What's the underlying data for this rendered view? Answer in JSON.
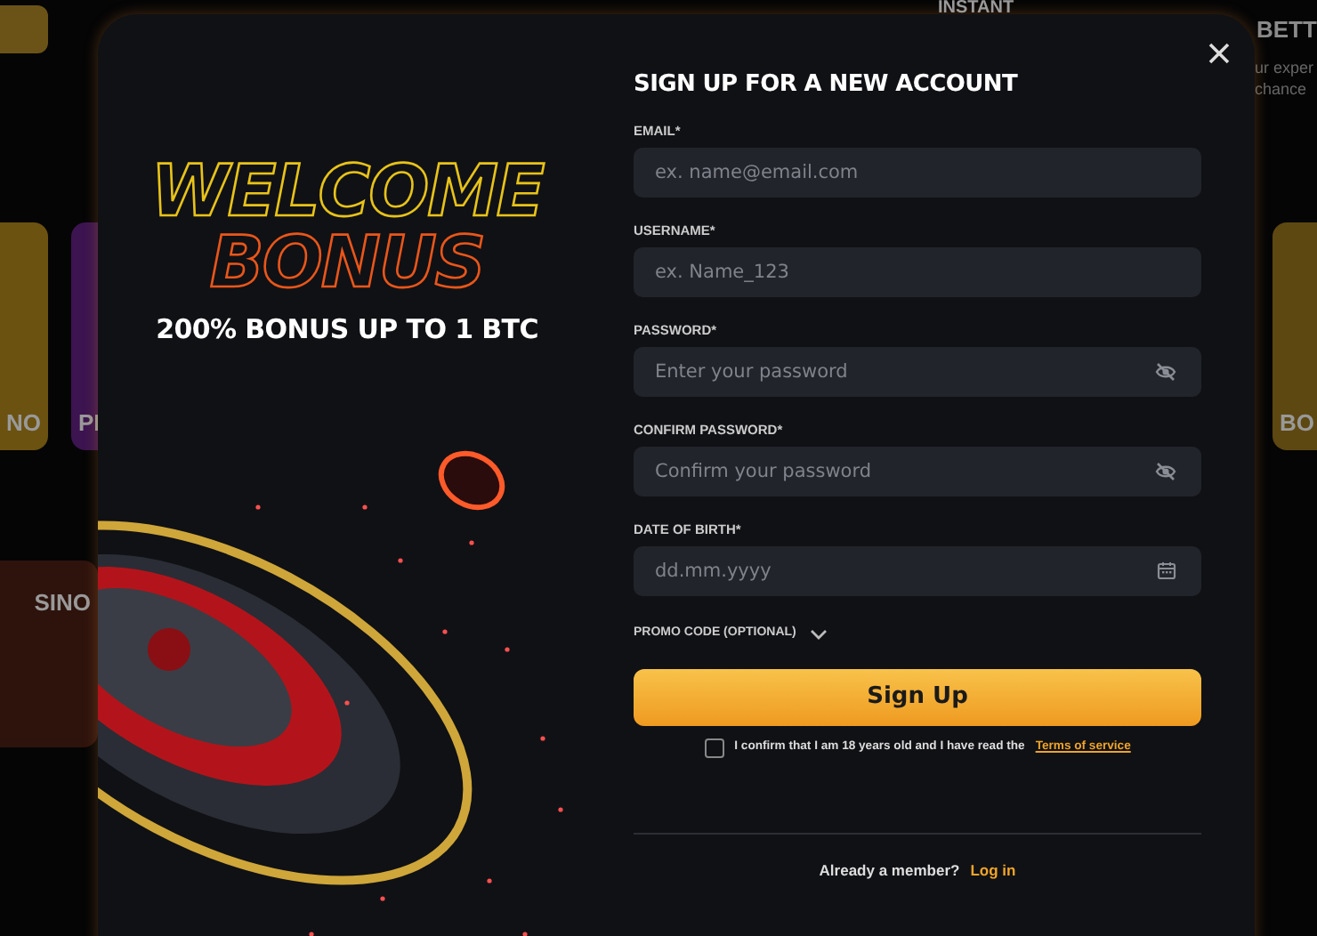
{
  "background": {
    "top_texts": [
      {
        "kind": "heading",
        "text": "INSTANT"
      },
      {
        "kind": "heading",
        "text": "BETT"
      },
      {
        "kind": "body",
        "text": "ur exper"
      },
      {
        "kind": "body",
        "text": "chance"
      }
    ],
    "tiles": [
      {
        "text": "NO",
        "color": "#6b5210"
      },
      {
        "text": "PI",
        "color": "#3c1450"
      },
      {
        "text": "SINO",
        "color": "#2e130d"
      },
      {
        "text": "BO",
        "color": "#5e4812"
      }
    ]
  },
  "promo": {
    "headline": [
      "WELCOME",
      "BONUS"
    ],
    "subline": "200% BONUS UP TO 1 BTC"
  },
  "form": {
    "title": "SIGN UP FOR A NEW ACCOUNT",
    "fields": [
      {
        "kind": "text",
        "label": "EMAIL*",
        "placeholder": "ex. name@email.com"
      },
      {
        "kind": "text",
        "label": "USERNAME*",
        "placeholder": "ex. Name_123"
      },
      {
        "kind": "password",
        "label": "PASSWORD*",
        "placeholder": "Enter your password"
      },
      {
        "kind": "password",
        "label": "CONFIRM PASSWORD*",
        "placeholder": "Confirm your password"
      },
      {
        "kind": "date",
        "label": "DATE OF BIRTH*",
        "placeholder": "dd.mm.yyyy"
      }
    ],
    "promo_code": {
      "label": "PROMO CODE (OPTIONAL)",
      "expanded": false
    },
    "submit": "Sign Up",
    "consent": {
      "text": "I confirm that I am 18 years old and I have read the",
      "link": "Terms of service",
      "checked": false
    },
    "login_prompt": {
      "text": "Already a member?",
      "link": "Log in"
    }
  }
}
